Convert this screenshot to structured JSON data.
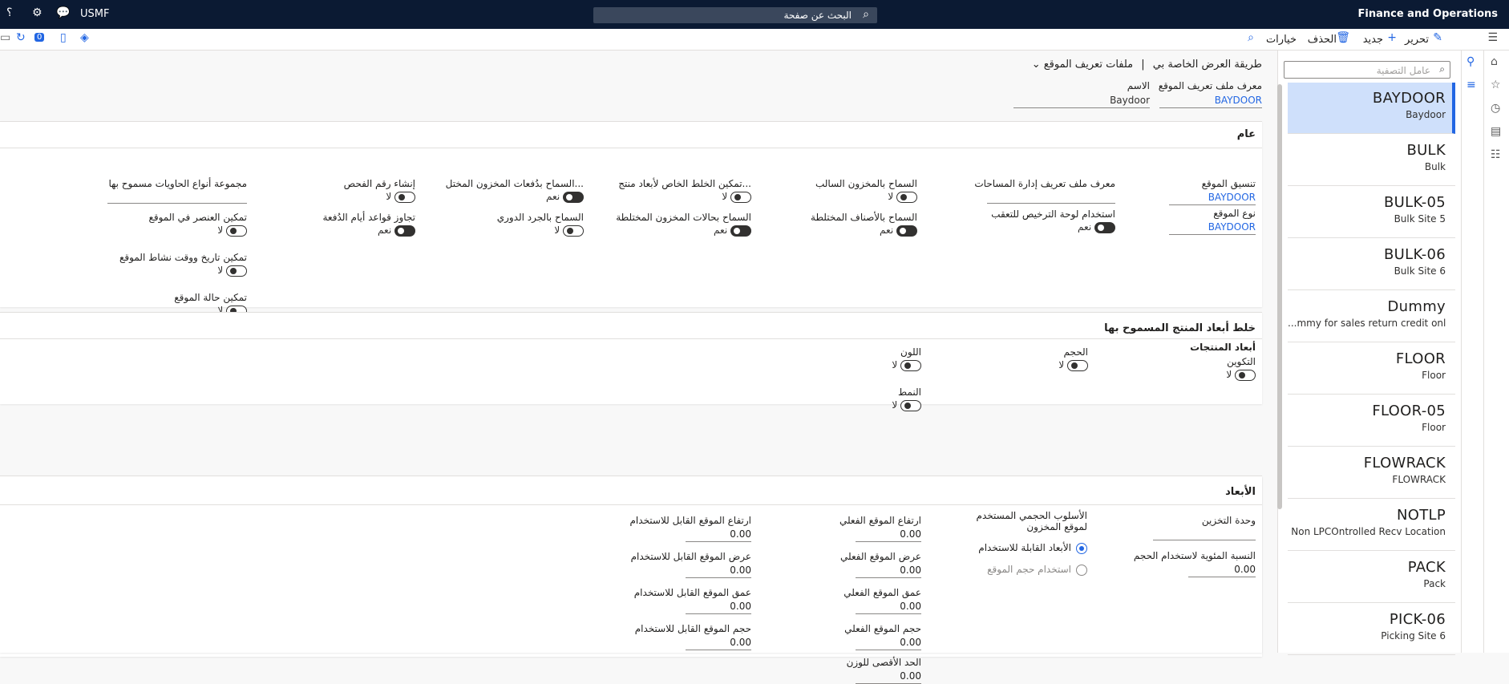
{
  "topbar": {
    "app_title": "Finance and Operations",
    "search_placeholder": "البحث عن صفحة",
    "company": "USMF",
    "help": "؟"
  },
  "command_bar": {
    "edit": "تحرير",
    "new": "جديد",
    "delete": "الحذف",
    "options": "خيارات",
    "badge": "0"
  },
  "breadcrumb": {
    "page": "ملفات تعريف الموقع",
    "view": "طريقة العرض الخاصة بي"
  },
  "header": {
    "profile_id_label": "معرف ملف تعريف الموقع",
    "profile_id_value": "BAYDOOR",
    "name_label": "الاسم",
    "name_value": "Baydoor"
  },
  "list": {
    "filter_placeholder": "عامل التصفية",
    "items": [
      {
        "id": "BAYDOOR",
        "desc": "Baydoor"
      },
      {
        "id": "BULK",
        "desc": "Bulk"
      },
      {
        "id": "BULK-05",
        "desc": "Bulk Site 5"
      },
      {
        "id": "BULK-06",
        "desc": "Bulk Site 6"
      },
      {
        "id": "Dummy",
        "desc": "...mmy for sales return credit only"
      },
      {
        "id": "FLOOR",
        "desc": "Floor"
      },
      {
        "id": "FLOOR-05",
        "desc": "Floor"
      },
      {
        "id": "FLOWRACK",
        "desc": "FLOWRACK"
      },
      {
        "id": "NOTLP",
        "desc": "Non LPCOntrolled Recv Location"
      },
      {
        "id": "PACK",
        "desc": "Pack"
      },
      {
        "id": "PICK-06",
        "desc": "Picking Site 6"
      }
    ]
  },
  "general": {
    "title": "عام",
    "location_format_label": "تنسيق الموقع",
    "location_format_value": "BAYDOOR",
    "location_type_label": "نوع الموقع",
    "location_type_value": "BAYDOOR",
    "space_mgmt_label": "معرف ملف تعريف إدارة المساحات",
    "lp_tracking_label": "استخدام لوحة الترخيص للتعقب",
    "lp_tracking_value": "نعم",
    "negative_inv_label": "السماح بالمخزون السالب",
    "negative_inv_value": "لا",
    "mixed_items_label": "السماح بالأصناف المختلطة",
    "mixed_items_value": "نعم",
    "mixed_dims_label": "تمكين الخلط الخاص لأبعاد منتج...",
    "mixed_dims_value": "لا",
    "mixed_status_label": "السماح بحالات المخزون المختلطة",
    "mixed_status_value": "نعم",
    "mixed_batches_label": "السماح بدُفعات المخزون المختل...",
    "mixed_batches_value": "نعم",
    "cycle_count_label": "السماح بالجرد الدوري",
    "cycle_count_value": "لا",
    "check_digit_label": "إنشاء رقم الفحص",
    "check_digit_value": "لا",
    "batch_days_label": "تجاوز قواعد أيام الدُفعة",
    "batch_days_value": "نعم",
    "container_group_label": "مجموعة أنواع الحاويات مسموح بها",
    "item_in_loc_label": "تمكين العنصر في الموقع",
    "item_in_loc_value": "لا",
    "activity_date_label": "تمكين تاريخ ووقت نشاط الموقع",
    "activity_date_value": "لا",
    "loc_status_label": "تمكين حالة الموقع",
    "loc_status_value": "لا"
  },
  "mixing": {
    "title": "خلط أبعاد المنتج المسموح بها",
    "product_dims_heading": "أبعاد المنتجات",
    "config_label": "التكوين",
    "config_value": "لا",
    "size_label": "الحجم",
    "size_value": "لا",
    "color_label": "اللون",
    "color_value": "لا",
    "style_label": "النمط",
    "style_value": "لا"
  },
  "dimensions": {
    "title": "الأبعاد",
    "storage_unit_label": "وحدة التخزين",
    "volume_pct_label": "النسبة المئوية لاستخدام الحجم",
    "volume_pct_value": "0.00",
    "volumetric_method_label": "الأسلوب الحجمي المستخدم لموقع المخزون",
    "radio_usable_dims": "الأبعاد القابلة للاستخدام",
    "radio_location_volume": "استخدام حجم الموقع",
    "phys_height_label": "ارتفاع الموقع الفعلي",
    "phys_height_value": "0.00",
    "phys_width_label": "عرض الموقع الفعلي",
    "phys_width_value": "0.00",
    "phys_depth_label": "عمق الموقع الفعلي",
    "phys_depth_value": "0.00",
    "phys_volume_label": "حجم الموقع الفعلي",
    "phys_volume_value": "0.00",
    "max_weight_label": "الحد الأقصى للوزن",
    "max_weight_value": "0.00",
    "usable_height_label": "ارتفاع الموقع القابل للاستخدام",
    "usable_height_value": "0.00",
    "usable_width_label": "عرض الموقع القابل للاستخدام",
    "usable_width_value": "0.00",
    "usable_depth_label": "عمق الموقع القابل للاستخدام",
    "usable_depth_value": "0.00",
    "usable_volume_label": "حجم الموقع القابل للاستخدام",
    "usable_volume_value": "0.00"
  }
}
